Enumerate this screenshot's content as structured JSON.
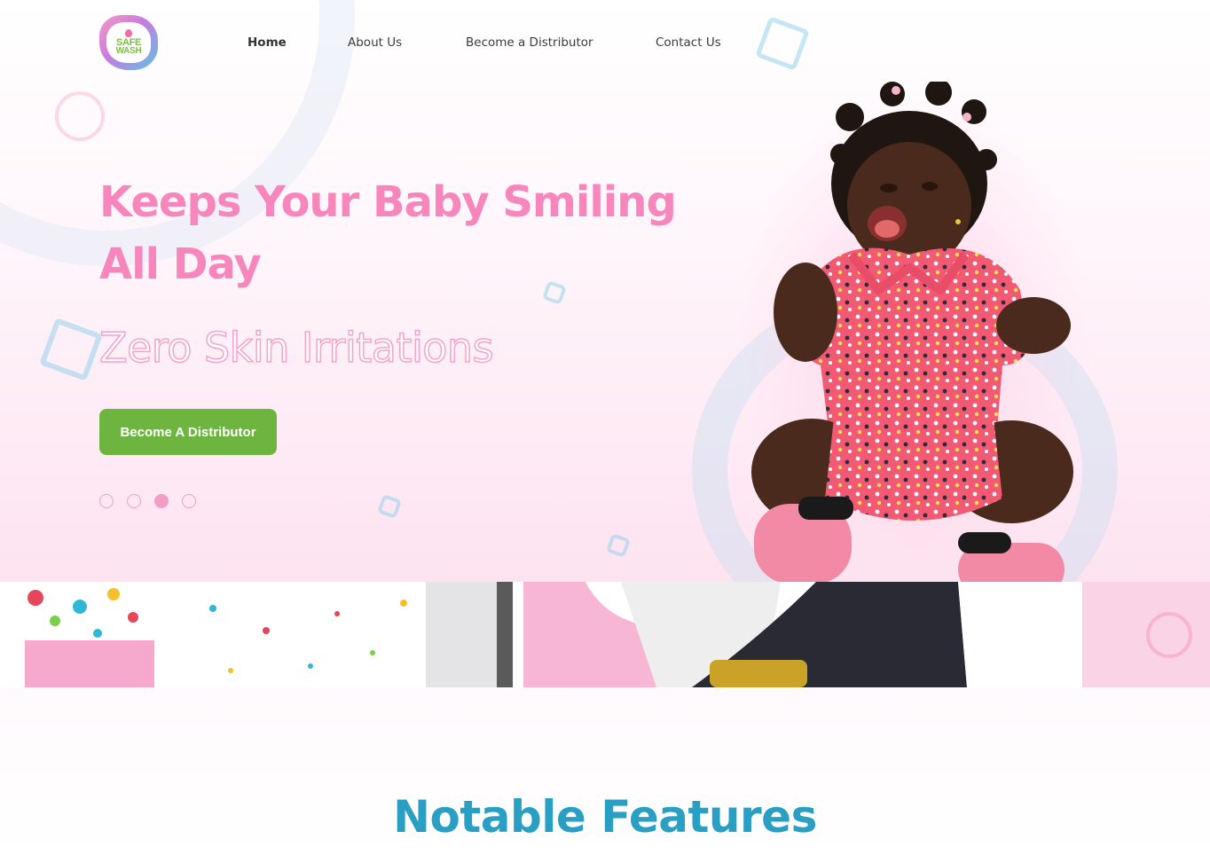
{
  "brand": {
    "logo_line1": "SAFE",
    "logo_line2": "WASH"
  },
  "nav": {
    "items": [
      {
        "label": "Home",
        "active": true
      },
      {
        "label": "About Us",
        "active": false
      },
      {
        "label": "Become a Distributor",
        "active": false
      },
      {
        "label": "Contact Us",
        "active": false
      }
    ]
  },
  "hero": {
    "headline_line1": "Keeps Your Baby Smiling",
    "headline_line2": "All Day",
    "subline": "Zero Skin Irritations",
    "cta_label": "Become A Distributor",
    "slider": {
      "count": 4,
      "active_index": 2
    }
  },
  "features": {
    "title": "Notable Features"
  },
  "colors": {
    "accent_pink": "#f786bd",
    "cta_green": "#6eb53f",
    "heading_blue": "#2a9fc4"
  }
}
